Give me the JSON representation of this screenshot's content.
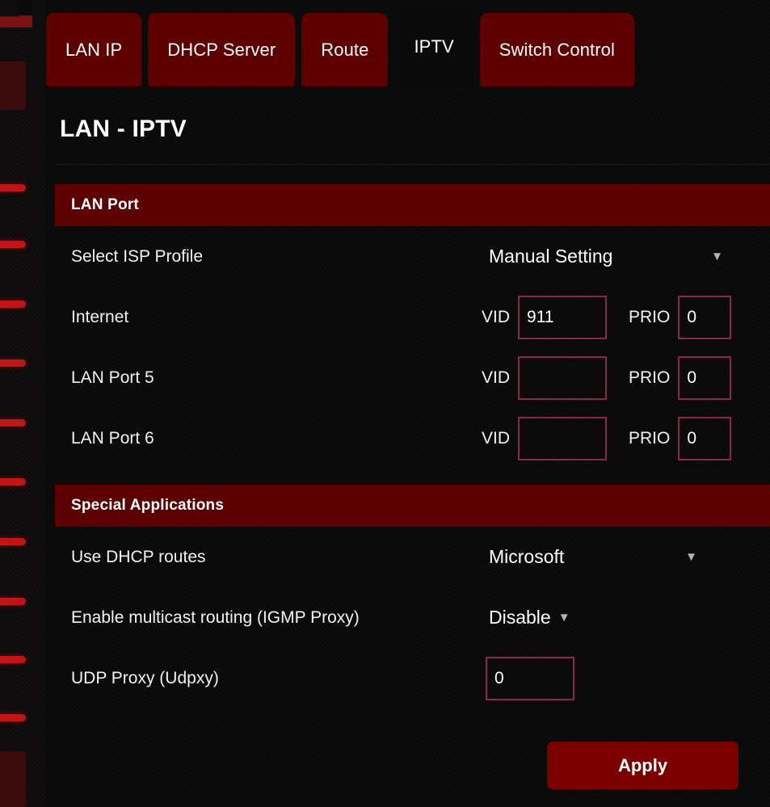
{
  "tabs": [
    {
      "label": "LAN IP",
      "active": false
    },
    {
      "label": "DHCP Server",
      "active": false
    },
    {
      "label": "Route",
      "active": false
    },
    {
      "label": "IPTV",
      "active": true
    },
    {
      "label": "Switch Control",
      "active": false
    }
  ],
  "page": {
    "title": "LAN - IPTV"
  },
  "lan_port_section": {
    "header": "LAN Port",
    "isp_profile": {
      "label": "Select ISP Profile",
      "value": "Manual Setting",
      "caret": "▼"
    },
    "rows": [
      {
        "label": "Internet",
        "vid_tag": "VID",
        "vid_value": "911",
        "prio_tag": "PRIO",
        "prio_value": "0"
      },
      {
        "label": "LAN Port 5",
        "vid_tag": "VID",
        "vid_value": "",
        "prio_tag": "PRIO",
        "prio_value": "0"
      },
      {
        "label": "LAN Port 6",
        "vid_tag": "VID",
        "vid_value": "",
        "prio_tag": "PRIO",
        "prio_value": "0"
      }
    ]
  },
  "special_applications_section": {
    "header": "Special Applications",
    "dhcp_routes": {
      "label": "Use DHCP routes",
      "value": "Microsoft",
      "caret": "▼"
    },
    "igmp_proxy": {
      "label": "Enable multicast routing (IGMP Proxy)",
      "value": "Disable",
      "caret": "▼"
    },
    "udp_proxy": {
      "label": "UDP Proxy (Udpxy)",
      "value": "0"
    }
  },
  "actions": {
    "apply_label": "Apply"
  },
  "colors": {
    "accent_red": "#5c0000",
    "button_red": "#7a0000",
    "tab_red": "#5e0000",
    "input_border": "#8b2942",
    "sidebar_accent": "#c11515",
    "background": "#0a0909"
  }
}
